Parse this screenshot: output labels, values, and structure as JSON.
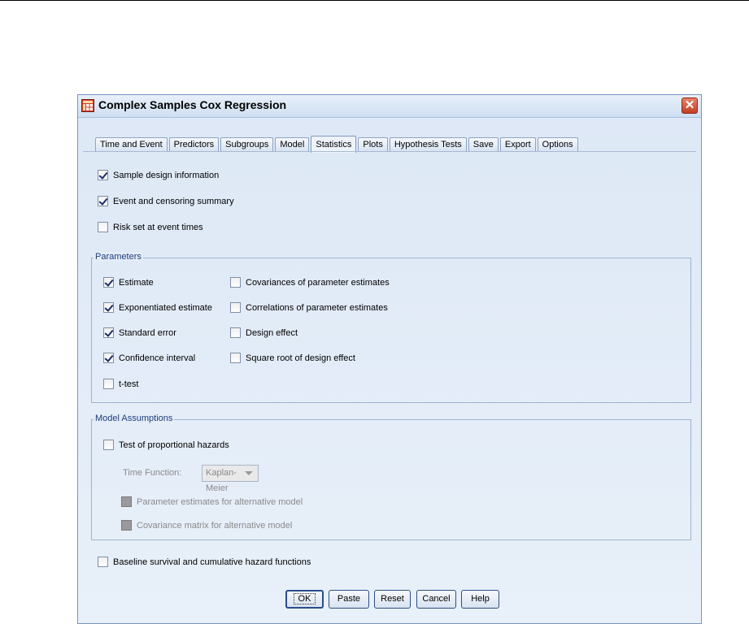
{
  "window": {
    "title": "Complex Samples Cox Regression",
    "close_glyph": "✕",
    "icon": "table-app-icon"
  },
  "tabs": [
    {
      "label": "Time and Event",
      "active": false
    },
    {
      "label": "Predictors",
      "active": false
    },
    {
      "label": "Subgroups",
      "active": false
    },
    {
      "label": "Model",
      "active": false
    },
    {
      "label": "Statistics",
      "active": true
    },
    {
      "label": "Plots",
      "active": false
    },
    {
      "label": "Hypothesis Tests",
      "active": false
    },
    {
      "label": "Save",
      "active": false
    },
    {
      "label": "Export",
      "active": false
    },
    {
      "label": "Options",
      "active": false
    }
  ],
  "top_options": [
    {
      "label": "Sample design information",
      "checked": true
    },
    {
      "label": "Event and censoring summary",
      "checked": true
    },
    {
      "label": "Risk set at event times",
      "checked": false
    }
  ],
  "parameters": {
    "title": "Parameters",
    "left": [
      {
        "label": "Estimate",
        "checked": true
      },
      {
        "label": "Exponentiated estimate",
        "checked": true
      },
      {
        "label": "Standard error",
        "checked": true
      },
      {
        "label": "Confidence interval",
        "checked": true
      },
      {
        "label": "t-test",
        "checked": false
      }
    ],
    "right": [
      {
        "label": "Covariances of parameter estimates",
        "checked": false
      },
      {
        "label": "Correlations of parameter estimates",
        "checked": false
      },
      {
        "label": "Design effect",
        "checked": false
      },
      {
        "label": "Square root of design effect",
        "checked": false
      }
    ]
  },
  "model_assumptions": {
    "title": "Model Assumptions",
    "test_label": "Test of proportional hazards",
    "test_checked": false,
    "time_function_label": "Time Function:",
    "time_function_value": "Kaplan-Meier",
    "disabled_options": [
      {
        "label": "Parameter estimates for alternative model"
      },
      {
        "label": "Covariance matrix for alternative model"
      }
    ]
  },
  "baseline": {
    "label": "Baseline survival and cumulative hazard functions",
    "checked": false
  },
  "buttons": {
    "ok": "OK",
    "paste": "Paste",
    "reset": "Reset",
    "cancel": "Cancel",
    "help": "Help"
  }
}
